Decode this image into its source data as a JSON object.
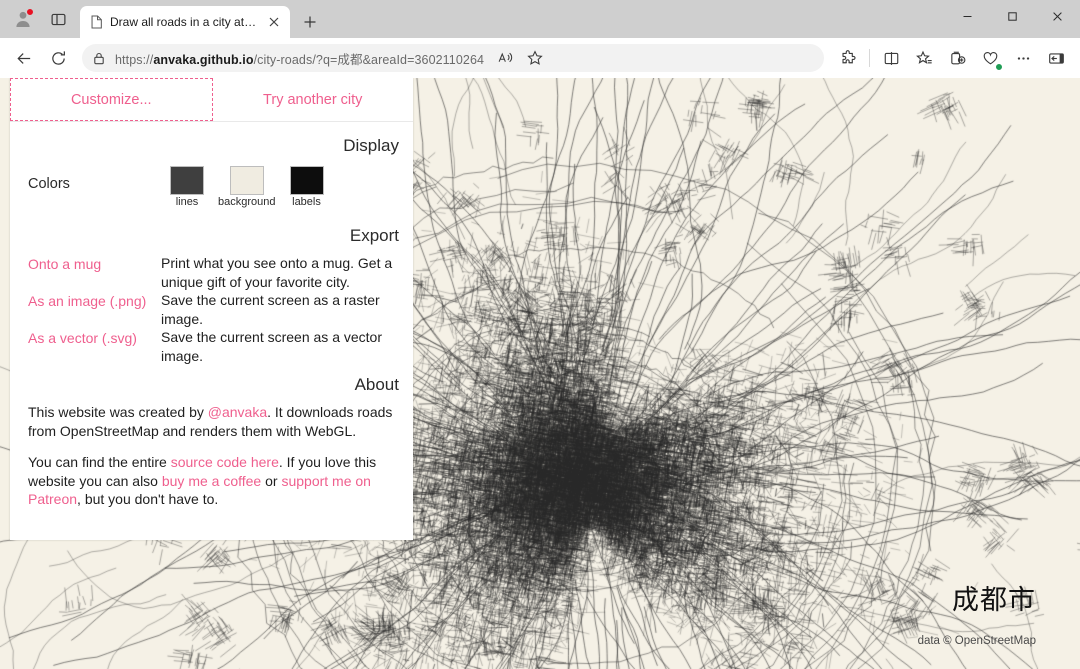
{
  "browser": {
    "profile_icon": "account-avatar",
    "tab_actions_icon": "tab-actions-menu",
    "tab": {
      "title": "Draw all roads in a city at once",
      "favicon": "page-icon",
      "close_icon": "close-icon"
    },
    "new_tab_icon": "plus-icon",
    "window_controls": {
      "minimize": "minimize-icon",
      "maximize": "maximize-icon",
      "close": "close-icon"
    },
    "nav": {
      "back_icon": "back-arrow-icon",
      "refresh_icon": "refresh-icon"
    },
    "omnibox": {
      "lock_icon": "lock-icon",
      "url_prefix": "https://",
      "url_domain": "anvaka.github.io",
      "url_path": "/city-roads/?q=成都&areaId=3602110264",
      "read_aloud_icon": "read-aloud-icon",
      "favorite_icon": "star-icon"
    },
    "toolbar_icons": [
      "extensions-icon",
      "split-screen-icon",
      "favorites-icon",
      "collections-icon",
      "browser-essentials-icon",
      "settings-more-icon",
      "sidebar-toggle-icon"
    ]
  },
  "panel": {
    "tabs": [
      {
        "label": "Customize...",
        "active": true
      },
      {
        "label": "Try another city",
        "active": false
      }
    ],
    "display": {
      "heading": "Display",
      "colors_label": "Colors",
      "swatches": [
        {
          "name": "lines",
          "color": "#3f3f3f"
        },
        {
          "name": "background",
          "color": "#f0ece1"
        },
        {
          "name": "labels",
          "color": "#0d0d0d"
        }
      ]
    },
    "export": {
      "heading": "Export",
      "items": [
        {
          "link": "Onto a mug",
          "desc": "Print what you see onto a mug. Get a unique gift of your favorite city."
        },
        {
          "link": "As an image (.png)",
          "desc": "Save the current screen as a raster image."
        },
        {
          "link": "As a vector (.svg)",
          "desc": "Save the current screen as a vector image."
        }
      ]
    },
    "about": {
      "heading": "About",
      "p1_before": "This website was created by ",
      "p1_link": "@anvaka",
      "p1_after": ". It downloads roads from OpenStreetMap and renders them with WebGL.",
      "p2_before": "You can find the entire ",
      "p2_link1": "source code here",
      "p2_mid1": ". If you love this website you can also ",
      "p2_link2": "buy me a coffee",
      "p2_mid2": " or ",
      "p2_link3": "support me on Patreon",
      "p2_after": ", but you don't have to."
    }
  },
  "map": {
    "city_label": "成都市",
    "attribution": "data © OpenStreetMap",
    "background_color": "#f5f1e6",
    "line_color": "#2a2a2a"
  }
}
